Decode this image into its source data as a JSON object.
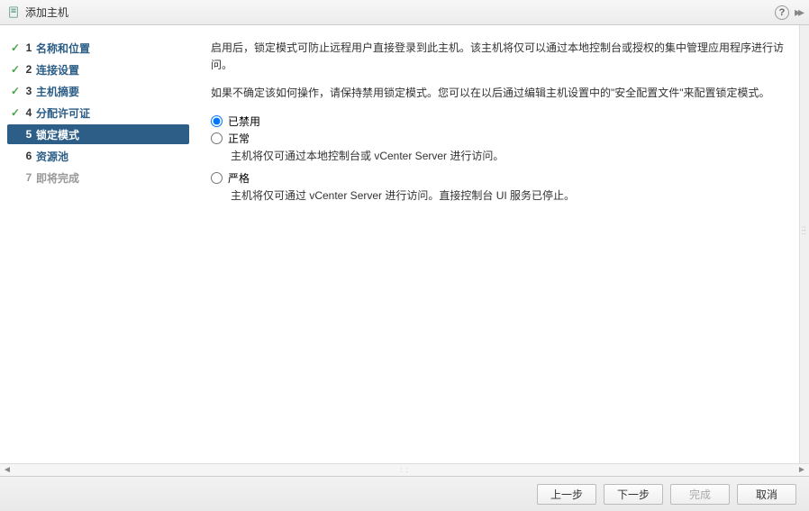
{
  "title": "添加主机",
  "steps": [
    {
      "num": "1",
      "label": "名称和位置",
      "done": true
    },
    {
      "num": "2",
      "label": "连接设置",
      "done": true
    },
    {
      "num": "3",
      "label": "主机摘要",
      "done": true
    },
    {
      "num": "4",
      "label": "分配许可证",
      "done": true
    },
    {
      "num": "5",
      "label": "锁定模式",
      "active": true
    },
    {
      "num": "6",
      "label": "资源池"
    },
    {
      "num": "7",
      "label": "即将完成",
      "disabled": true
    }
  ],
  "content": {
    "para1": "启用后，锁定模式可防止远程用户直接登录到此主机。该主机将仅可以通过本地控制台或授权的集中管理应用程序进行访问。",
    "para2": "如果不确定该如何操作，请保持禁用锁定模式。您可以在以后通过编辑主机设置中的\"安全配置文件\"来配置锁定模式。",
    "options": {
      "disabled": {
        "label": "已禁用"
      },
      "normal": {
        "label": "正常",
        "desc": "主机将仅可通过本地控制台或 vCenter Server 进行访问。"
      },
      "strict": {
        "label": "严格",
        "desc": "主机将仅可通过 vCenter Server 进行访问。直接控制台 UI 服务已停止。"
      }
    }
  },
  "footer": {
    "back": "上一步",
    "next": "下一步",
    "finish": "完成",
    "cancel": "取消"
  }
}
